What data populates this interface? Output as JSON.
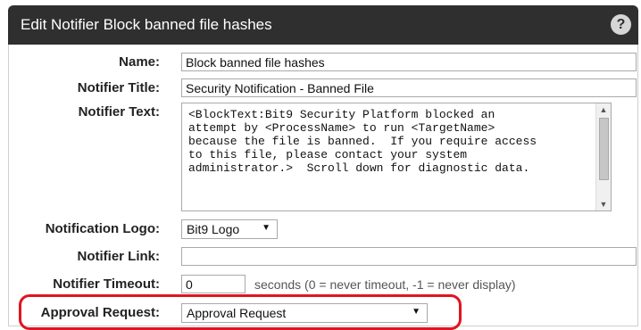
{
  "dialog": {
    "title": "Edit Notifier Block banned file hashes",
    "help_glyph": "?"
  },
  "form": {
    "name_label": "Name:",
    "name_value": "Block banned file hashes",
    "notifier_title_label": "Notifier Title:",
    "notifier_title_value": "Security Notification - Banned File",
    "notifier_text_label": "Notifier Text:",
    "notifier_text_value": "<BlockText:Bit9 Security Platform blocked an\nattempt by <ProcessName> to run <TargetName>\nbecause the file is banned.  If you require access\nto this file, please contact your system\nadministrator.>  Scroll down for diagnostic data.",
    "notification_logo_label": "Notification Logo:",
    "notification_logo_value": "Bit9 Logo",
    "notifier_link_label": "Notifier Link:",
    "notifier_link_value": "",
    "notifier_timeout_label": "Notifier Timeout:",
    "notifier_timeout_value": "0",
    "notifier_timeout_hint": "seconds (0 = never timeout, -1 = never display)",
    "approval_request_label": "Approval Request:",
    "approval_request_value": "Approval Request"
  },
  "colors": {
    "titlebar": "#2f2f2f",
    "highlight": "#e0151e"
  }
}
